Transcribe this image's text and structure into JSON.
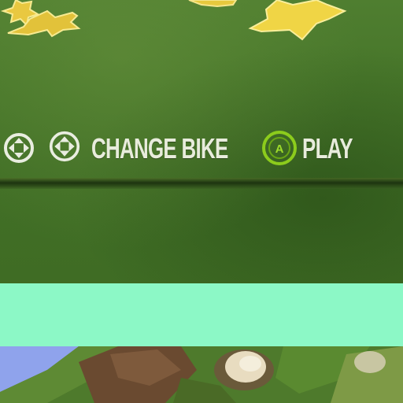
{
  "menu": {
    "change_bike_label": "CHANGE BIKE",
    "play_label": "PLAY",
    "play_button_glyph": "A"
  },
  "icons": {
    "left_stick": "dpad-left-icon",
    "right_stick": "dpad-right-icon",
    "a_button": "a-button-icon",
    "decor": "star-icon"
  },
  "colors": {
    "panel_green": "#47762a",
    "label_white": "#e8ecdc",
    "a_button_green": "#8ccc1c",
    "teal_band": "#8cf8c6",
    "star_yellow": "#f2d94a"
  }
}
